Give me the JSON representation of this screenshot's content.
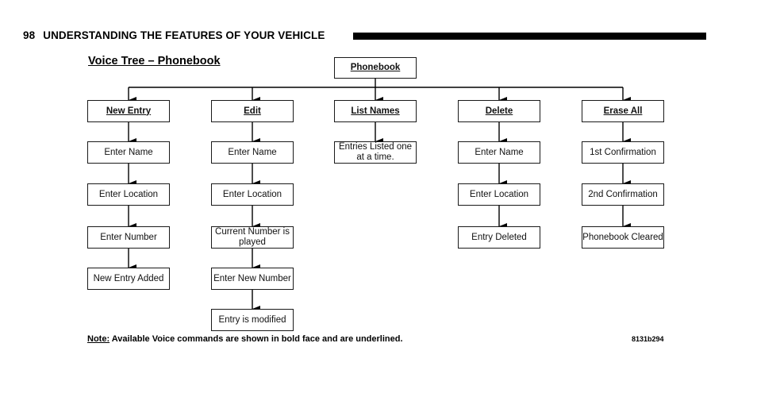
{
  "header": {
    "page_number": "98",
    "section_title": "UNDERSTANDING THE FEATURES OF YOUR VEHICLE"
  },
  "diagram": {
    "title": "Voice Tree – Phonebook",
    "root": "Phonebook",
    "columns": [
      {
        "command": "New Entry",
        "steps": [
          "Enter Name",
          "Enter Location",
          "Enter Number",
          "New Entry Added"
        ]
      },
      {
        "command": "Edit",
        "steps": [
          "Enter Name",
          "Enter Location",
          "Current Number is played",
          "Enter New Number",
          "Entry is modified"
        ]
      },
      {
        "command": "List Names",
        "steps": [
          "Entries Listed one at a time."
        ]
      },
      {
        "command": "Delete",
        "steps": [
          "Enter Name",
          "Enter Location",
          "Entry Deleted"
        ]
      },
      {
        "command": "Erase All",
        "steps": [
          "1st Confirmation",
          "2nd Confirmation",
          "Phonebook Cleared"
        ]
      }
    ]
  },
  "note": {
    "label": "Note:",
    "text": " Available Voice commands are shown in bold face and are underlined."
  },
  "figure_code": "8131b294"
}
